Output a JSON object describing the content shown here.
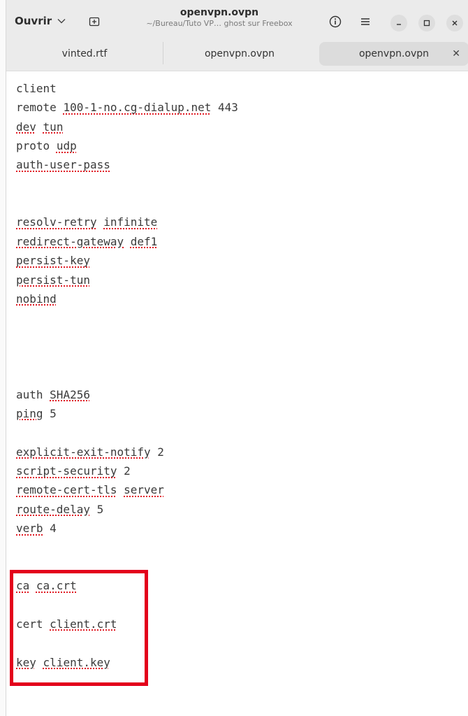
{
  "header": {
    "open_label": "Ouvrir",
    "title": "openvpn.ovpn",
    "subtitle": "~/Bureau/Tuto VP… ghost sur Freebox"
  },
  "tabs": [
    {
      "label": "vinted.rtf"
    },
    {
      "label": "openvpn.ovpn"
    },
    {
      "label": "openvpn.ovpn",
      "active": true
    }
  ],
  "editor": {
    "lines": [
      [
        {
          "t": "client",
          "s": false
        }
      ],
      [
        {
          "t": "remote",
          "s": false
        },
        {
          "t": " ",
          "s": false
        },
        {
          "t": "100-1-no.cg-dialup.net",
          "s": true
        },
        {
          "t": " 443",
          "s": false
        }
      ],
      [
        {
          "t": "dev",
          "s": true
        },
        {
          "t": " ",
          "s": false
        },
        {
          "t": "tun",
          "s": true
        }
      ],
      [
        {
          "t": "proto",
          "s": false
        },
        {
          "t": " ",
          "s": false
        },
        {
          "t": "udp",
          "s": true
        }
      ],
      [
        {
          "t": "auth-user-pass",
          "s": true
        }
      ],
      [],
      [],
      [
        {
          "t": "resolv-retry",
          "s": true
        },
        {
          "t": " ",
          "s": false
        },
        {
          "t": "infinite",
          "s": true
        }
      ],
      [
        {
          "t": "redirect-gateway",
          "s": true
        },
        {
          "t": " ",
          "s": false
        },
        {
          "t": "def1",
          "s": true
        }
      ],
      [
        {
          "t": "persist-key",
          "s": true
        }
      ],
      [
        {
          "t": "persist-tun",
          "s": true
        }
      ],
      [
        {
          "t": "nobind",
          "s": true
        }
      ],
      [],
      [],
      [],
      [],
      [
        {
          "t": "auth",
          "s": false
        },
        {
          "t": " ",
          "s": false
        },
        {
          "t": "SHA256",
          "s": true
        }
      ],
      [
        {
          "t": "ping",
          "s": true
        },
        {
          "t": " 5",
          "s": false
        }
      ],
      [],
      [
        {
          "t": "explicit-exit-notify",
          "s": true
        },
        {
          "t": " 2",
          "s": false
        }
      ],
      [
        {
          "t": "script-security",
          "s": true
        },
        {
          "t": " 2",
          "s": false
        }
      ],
      [
        {
          "t": "remote-cert-tls",
          "s": true
        },
        {
          "t": " ",
          "s": false
        },
        {
          "t": "server",
          "s": true
        }
      ],
      [
        {
          "t": "route-delay",
          "s": true
        },
        {
          "t": " 5",
          "s": false
        }
      ],
      [
        {
          "t": "verb",
          "s": true
        },
        {
          "t": " 4",
          "s": false
        }
      ],
      [],
      [],
      [
        {
          "t": "ca",
          "s": true
        },
        {
          "t": " ",
          "s": false
        },
        {
          "t": "ca.crt",
          "s": true
        }
      ],
      [],
      [
        {
          "t": "cert",
          "s": false
        },
        {
          "t": " ",
          "s": false
        },
        {
          "t": "client.crt",
          "s": true
        }
      ],
      [],
      [
        {
          "t": "key",
          "s": true
        },
        {
          "t": " ",
          "s": false
        },
        {
          "t": "client.key",
          "s": true
        }
      ]
    ]
  },
  "colors": {
    "spell_underline": "#e01b24",
    "highlight_box": "#e3001b",
    "header_bg": "#ebebeb"
  }
}
